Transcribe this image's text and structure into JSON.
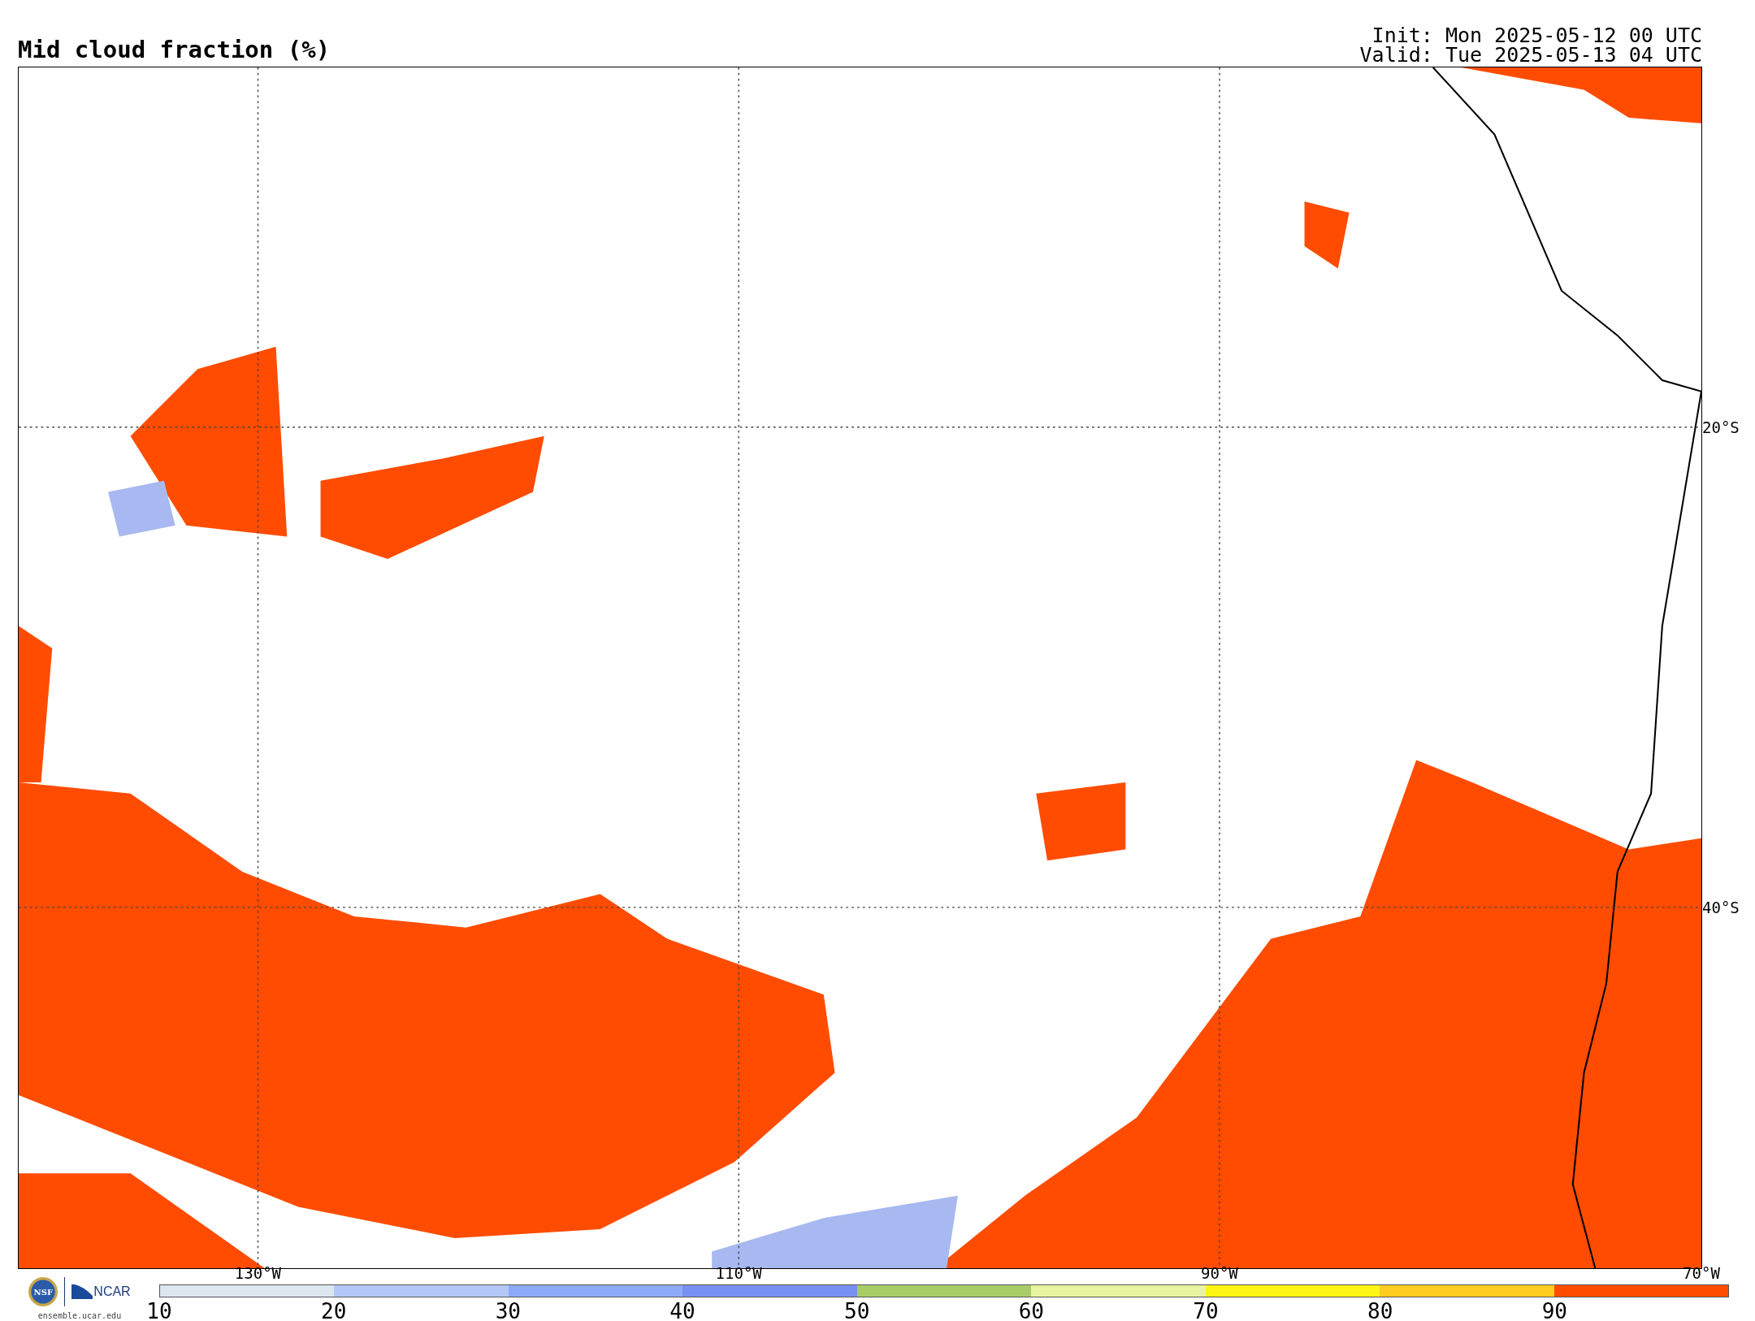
{
  "title": "Mid cloud fraction (%)",
  "init": "Init: Mon 2025-05-12 00 UTC",
  "valid": "Valid: Tue 2025-05-13 04 UTC",
  "map": {
    "lon_labels": [
      "130°W",
      "110°W",
      "90°W",
      "70°W"
    ],
    "lat_labels": [
      "20°S",
      "40°S"
    ]
  },
  "logos": {
    "nsf": "NSF",
    "ncar": "NCAR",
    "url": "ensemble.ucar.edu"
  },
  "colorbar": [
    {
      "label": "10",
      "color": "#dce6ee"
    },
    {
      "label": "20",
      "color": "#b4c8f8"
    },
    {
      "label": "30",
      "color": "#8caaf8"
    },
    {
      "label": "40",
      "color": "#7890f0"
    },
    {
      "label": "50",
      "color": "#a8cc68"
    },
    {
      "label": "60",
      "color": "#e8f4a0"
    },
    {
      "label": "70",
      "color": "#fff514"
    },
    {
      "label": "80",
      "color": "#ffcc22"
    },
    {
      "label": "90",
      "color": "#ff4c00"
    }
  ]
}
